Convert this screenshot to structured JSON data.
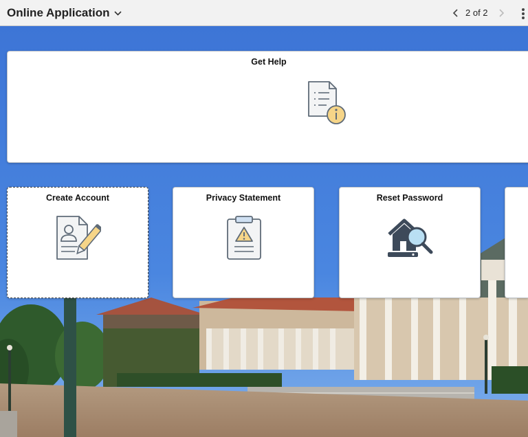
{
  "header": {
    "app_title": "Online Application",
    "pager_text": "2 of 2"
  },
  "tiles": [
    {
      "title": "Get Help",
      "icon": "document-info-icon"
    },
    {
      "title": "Create Account",
      "icon": "profile-edit-icon"
    },
    {
      "title": "Privacy Statement",
      "icon": "clipboard-warning-icon"
    },
    {
      "title": "Reset Password",
      "icon": "house-search-icon"
    }
  ],
  "colors": {
    "sky": "#3f78d8",
    "header_bg": "#f2f2f2",
    "tile_bg": "#ffffff",
    "icon_accent": "#f6d588",
    "icon_stroke": "#5f6b78"
  }
}
